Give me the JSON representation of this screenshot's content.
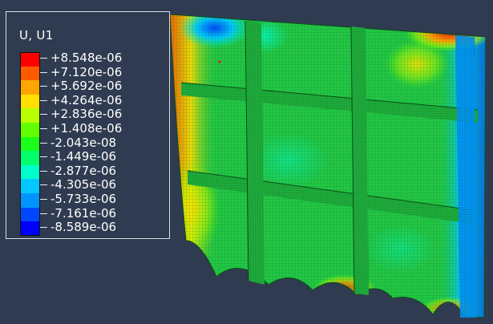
{
  "legend": {
    "title": "U, U1",
    "entries": [
      {
        "label": "+8.548e-06",
        "color": "#ff0000"
      },
      {
        "label": "+7.120e-06",
        "color": "#ff5a00"
      },
      {
        "label": "+5.692e-06",
        "color": "#ffa500"
      },
      {
        "label": "+4.264e-06",
        "color": "#ffe000"
      },
      {
        "label": "+2.836e-06",
        "color": "#b8ff00"
      },
      {
        "label": "+1.408e-06",
        "color": "#62ff00"
      },
      {
        "label": "-2.043e-08",
        "color": "#19ff19"
      },
      {
        "label": "-1.449e-06",
        "color": "#00ff6a"
      },
      {
        "label": "-2.877e-06",
        "color": "#00ffcb"
      },
      {
        "label": "-4.305e-06",
        "color": "#00c8ff"
      },
      {
        "label": "-5.733e-06",
        "color": "#0094ff"
      },
      {
        "label": "-7.161e-06",
        "color": "#0048ff"
      },
      {
        "label": "-8.589e-06",
        "color": "#0000ff"
      }
    ]
  },
  "model": {
    "base_color": "#22c645",
    "mesh_color": "#0f6b22"
  }
}
